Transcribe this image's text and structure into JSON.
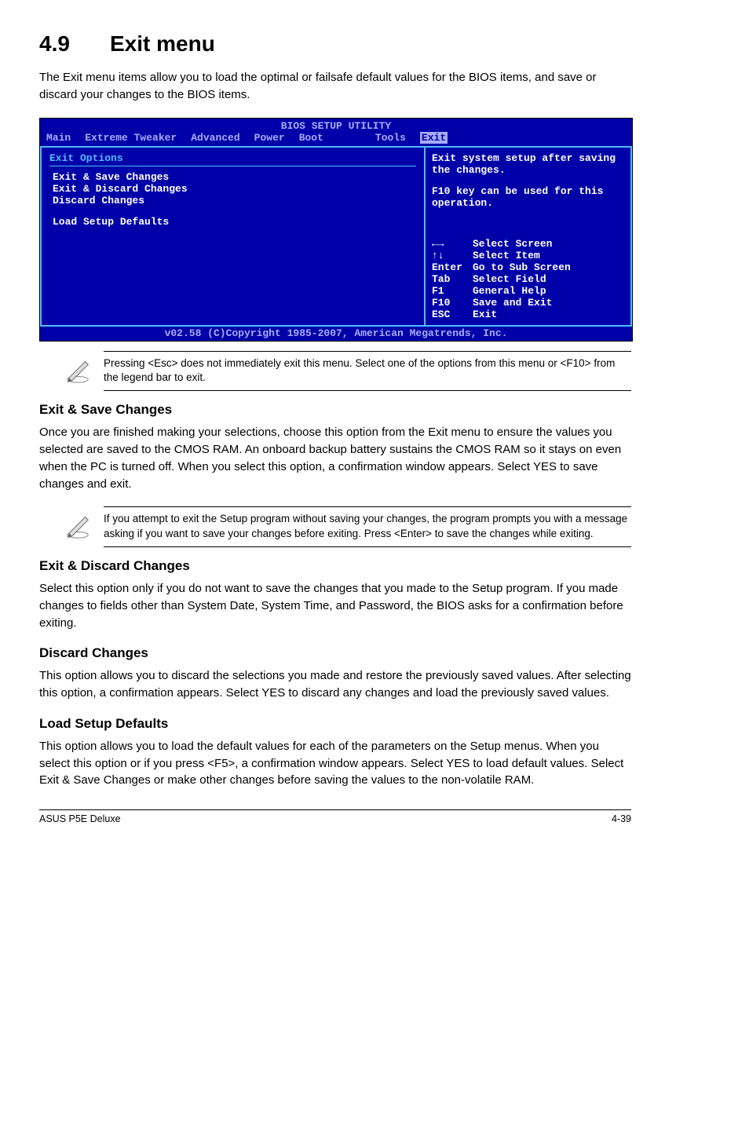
{
  "heading": {
    "number": "4.9",
    "title": "Exit menu"
  },
  "intro": "The Exit menu items allow you to load the optimal or failsafe default values for the BIOS items, and save or discard your changes to the BIOS items.",
  "bios": {
    "titlebar": "BIOS SETUP UTILITY",
    "tabs": {
      "main": "Main",
      "tweaker": "Extreme Tweaker",
      "advanced": "Advanced",
      "power": "Power",
      "boot": "Boot",
      "tools": "Tools",
      "exit": "Exit"
    },
    "left": {
      "options_title": "Exit Options",
      "items": {
        "save": "Exit & Save Changes",
        "discard_exit": "Exit & Discard Changes",
        "discard": "Discard Changes",
        "defaults": "Load Setup Defaults"
      }
    },
    "right": {
      "help1": "Exit system setup after saving the changes.",
      "help2": "F10 key can be used for this operation.",
      "keys": {
        "arrows_lr": "←→",
        "arrows_lr_label": "Select Screen",
        "arrows_ud": "↑↓",
        "arrows_ud_label": "Select Item",
        "enter": "Enter",
        "enter_label": "Go to Sub Screen",
        "tab": "Tab",
        "tab_label": "Select Field",
        "f1": "F1",
        "f1_label": "General Help",
        "f10": "F10",
        "f10_label": "Save and Exit",
        "esc": "ESC",
        "esc_label": "Exit"
      }
    },
    "copyright": "v02.58 (C)Copyright 1985-2007, American Megatrends, Inc."
  },
  "note1": "Pressing <Esc> does not immediately exit this menu. Select one of the options from this menu or <F10> from the legend bar to exit.",
  "sections": {
    "s1": {
      "title": "Exit & Save Changes",
      "body": "Once you are finished making your selections, choose this option from the Exit menu to ensure the values you selected are saved to the CMOS RAM. An onboard backup battery sustains the CMOS RAM so it stays on even when the PC is turned off. When you select this option, a confirmation window appears. Select YES to save changes and exit."
    },
    "note2": "If you attempt to exit the Setup program without saving your changes, the program prompts you with a message asking if you want to save your changes before exiting. Press <Enter>  to save the  changes while exiting.",
    "s2": {
      "title": "Exit & Discard Changes",
      "body": "Select this option only if you do not want to save the changes that you  made to the Setup program. If you made changes to fields other than System Date, System Time, and Password, the BIOS asks for a confirmation before exiting."
    },
    "s3": {
      "title": "Discard Changes",
      "body": "This option allows you to discard the selections you made and restore the previously saved values. After selecting this option, a confirmation appears. Select YES to discard any changes and load the previously saved values."
    },
    "s4": {
      "title": "Load Setup Defaults",
      "body": "This option allows you to load the default values for each of the parameters on the Setup menus. When you select this option or if you press <F5>, a confirmation window appears. Select YES to load default values. Select Exit & Save Changes or make other changes before saving the values to the non-volatile RAM."
    }
  },
  "footer": {
    "left": "ASUS P5E Deluxe",
    "right": "4-39"
  }
}
